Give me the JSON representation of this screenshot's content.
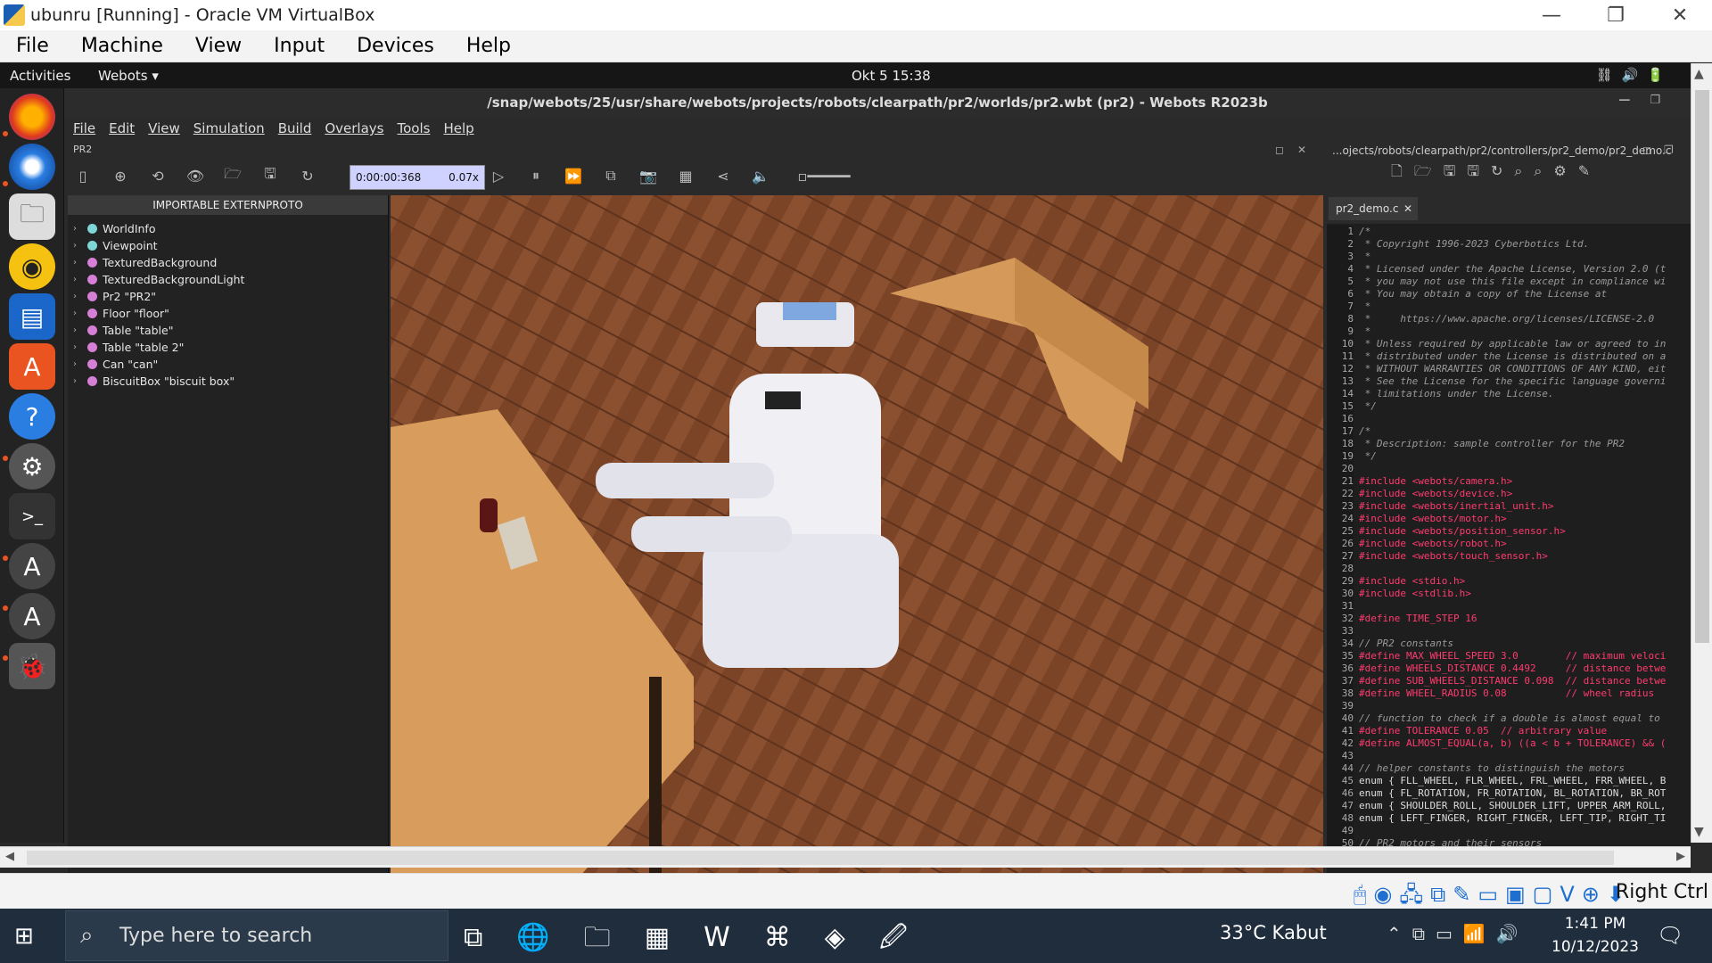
{
  "host_window": {
    "title": "ubunru [Running] - Oracle VM VirtualBox",
    "menu": [
      "File",
      "Machine",
      "View",
      "Input",
      "Devices",
      "Help"
    ],
    "status_label": "Right Ctrl"
  },
  "gnome": {
    "activities": "Activities",
    "app_name": "Webots ▾",
    "clock": "Okt 5  15:38"
  },
  "webots": {
    "title": "/snap/webots/25/usr/share/webots/projects/robots/clearpath/pr2/worlds/pr2.wbt (pr2) - Webots R2023b",
    "menu": [
      "File",
      "Edit",
      "View",
      "Simulation",
      "Build",
      "Overlays",
      "Tools",
      "Help"
    ],
    "sub_label": "PR2",
    "time": "0:00:00:368",
    "speed": "0.07x",
    "scene_header": "IMPORTABLE EXTERNPROTO",
    "scene_items": [
      {
        "label": "WorldInfo",
        "color": "#7fd6d6"
      },
      {
        "label": "Viewpoint",
        "color": "#7fd6d6"
      },
      {
        "label": "TexturedBackground",
        "color": "#d67fd6"
      },
      {
        "label": "TexturedBackgroundLight",
        "color": "#d67fd6"
      },
      {
        "label": "Pr2 \"PR2\"",
        "color": "#d67fd6"
      },
      {
        "label": "Floor \"floor\"",
        "color": "#d67fd6"
      },
      {
        "label": "Table \"table\"",
        "color": "#d67fd6"
      },
      {
        "label": "Table \"table 2\"",
        "color": "#d67fd6"
      },
      {
        "label": "Can \"can\"",
        "color": "#d67fd6"
      },
      {
        "label": "BiscuitBox \"biscuit box\"",
        "color": "#d67fd6"
      }
    ],
    "editor_path": "...ojects/robots/clearpath/pr2/controllers/pr2_demo/pr2_demo.c",
    "editor_tab": "pr2_demo.c",
    "code_lines": [
      {
        "t": "/*",
        "k": "c-com"
      },
      {
        "t": " * Copyright 1996-2023 Cyberbotics Ltd.",
        "k": "c-com"
      },
      {
        "t": " *",
        "k": "c-com"
      },
      {
        "t": " * Licensed under the Apache License, Version 2.0 (t",
        "k": "c-com"
      },
      {
        "t": " * you may not use this file except in compliance wi",
        "k": "c-com"
      },
      {
        "t": " * You may obtain a copy of the License at",
        "k": "c-com"
      },
      {
        "t": " *",
        "k": "c-com"
      },
      {
        "t": " *     https://www.apache.org/licenses/LICENSE-2.0",
        "k": "c-com"
      },
      {
        "t": " *",
        "k": "c-com"
      },
      {
        "t": " * Unless required by applicable law or agreed to in",
        "k": "c-com"
      },
      {
        "t": " * distributed under the License is distributed on a",
        "k": "c-com"
      },
      {
        "t": " * WITHOUT WARRANTIES OR CONDITIONS OF ANY KIND, eit",
        "k": "c-com"
      },
      {
        "t": " * See the License for the specific language governi",
        "k": "c-com"
      },
      {
        "t": " * limitations under the License.",
        "k": "c-com"
      },
      {
        "t": " */",
        "k": "c-com"
      },
      {
        "t": "",
        "k": "c-plain"
      },
      {
        "t": "/*",
        "k": "c-com"
      },
      {
        "t": " * Description: sample controller for the PR2",
        "k": "c-com"
      },
      {
        "t": " */",
        "k": "c-com"
      },
      {
        "t": "",
        "k": "c-plain"
      },
      {
        "t": "#include <webots/camera.h>",
        "k": "c-pre"
      },
      {
        "t": "#include <webots/device.h>",
        "k": "c-pre"
      },
      {
        "t": "#include <webots/inertial_unit.h>",
        "k": "c-pre"
      },
      {
        "t": "#include <webots/motor.h>",
        "k": "c-pre"
      },
      {
        "t": "#include <webots/position_sensor.h>",
        "k": "c-pre"
      },
      {
        "t": "#include <webots/robot.h>",
        "k": "c-pre"
      },
      {
        "t": "#include <webots/touch_sensor.h>",
        "k": "c-pre"
      },
      {
        "t": "",
        "k": "c-plain"
      },
      {
        "t": "#include <stdio.h>",
        "k": "c-pre"
      },
      {
        "t": "#include <stdlib.h>",
        "k": "c-pre"
      },
      {
        "t": "",
        "k": "c-plain"
      },
      {
        "t": "#define TIME_STEP 16",
        "k": "c-pre"
      },
      {
        "t": "",
        "k": "c-plain"
      },
      {
        "t": "// PR2 constants",
        "k": "c-com"
      },
      {
        "t": "#define MAX_WHEEL_SPEED 3.0        // maximum veloci",
        "k": "c-pre"
      },
      {
        "t": "#define WHEELS_DISTANCE 0.4492     // distance betwe",
        "k": "c-pre"
      },
      {
        "t": "#define SUB_WHEELS_DISTANCE 0.098  // distance betwe",
        "k": "c-pre"
      },
      {
        "t": "#define WHEEL_RADIUS 0.08          // wheel radius",
        "k": "c-pre"
      },
      {
        "t": "",
        "k": "c-plain"
      },
      {
        "t": "// function to check if a double is almost equal to",
        "k": "c-com"
      },
      {
        "t": "#define TOLERANCE 0.05  // arbitrary value",
        "k": "c-pre"
      },
      {
        "t": "#define ALMOST_EQUAL(a, b) ((a < b + TOLERANCE) && (",
        "k": "c-pre"
      },
      {
        "t": "",
        "k": "c-plain"
      },
      {
        "t": "// helper constants to distinguish the motors",
        "k": "c-com"
      },
      {
        "t": "enum { FLL_WHEEL, FLR_WHEEL, FRL_WHEEL, FRR_WHEEL, B",
        "k": "c-plain"
      },
      {
        "t": "enum { FL_ROTATION, FR_ROTATION, BL_ROTATION, BR_ROT",
        "k": "c-plain"
      },
      {
        "t": "enum { SHOULDER_ROLL, SHOULDER_LIFT, UPPER_ARM_ROLL,",
        "k": "c-plain"
      },
      {
        "t": "enum { LEFT_FINGER, RIGHT_FINGER, LEFT_TIP, RIGHT_TI",
        "k": "c-plain"
      },
      {
        "t": "",
        "k": "c-plain"
      },
      {
        "t": "// PR2 motors and their sensors",
        "k": "c-com"
      }
    ]
  },
  "taskbar": {
    "search_placeholder": "Type here to search",
    "weather": "33°C  Kabut",
    "time": "1:41 PM",
    "date": "10/12/2023"
  }
}
